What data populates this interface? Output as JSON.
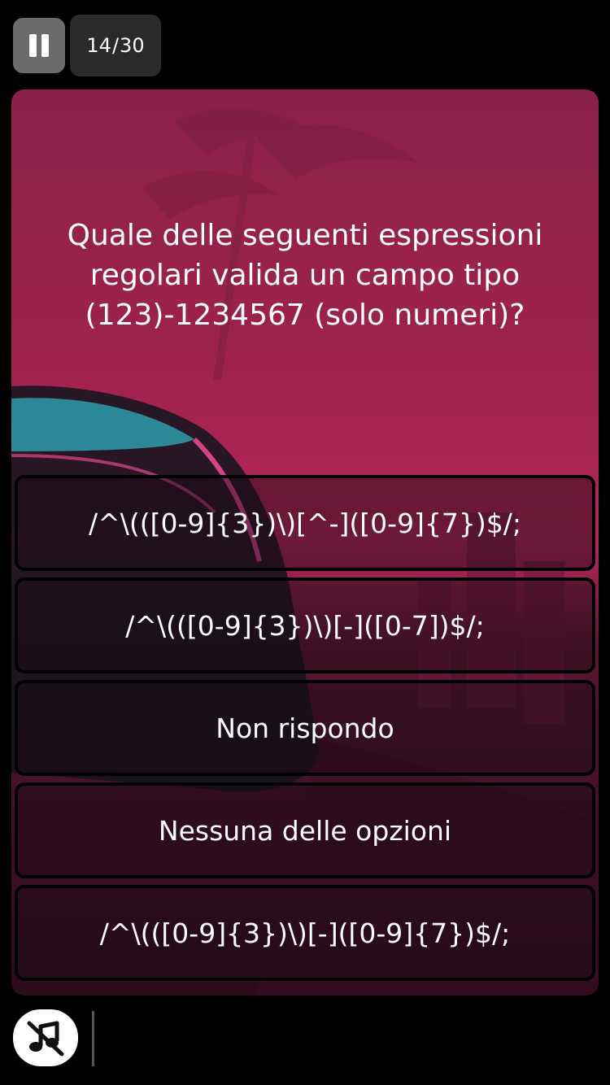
{
  "header": {
    "pause_icon": "pause-icon",
    "progress": {
      "current": "14",
      "separator": "/",
      "total": "30"
    }
  },
  "question": {
    "text": "Quale delle seguenti espressioni regolari valida un campo tipo (123)-1234567 (solo numeri)?"
  },
  "answers": [
    {
      "label": "/^\\(([0-9]{3})\\)[^-]([0-9]{7})$/;"
    },
    {
      "label": "/^\\(([0-9]{3})\\)[-]([0-7])$/;"
    },
    {
      "label": "Non rispondo"
    },
    {
      "label": "Nessuna delle opzioni"
    },
    {
      "label": "/^\\(([0-9]{3})\\)[-]([0-9]{7})$/;"
    }
  ],
  "footer": {
    "music_icon": "music-off-icon"
  },
  "colors": {
    "background": "#000000",
    "card_top": "#8a2148",
    "card_mid": "#b32759",
    "card_bottom": "#2a0c1a",
    "pause_bg": "#6b6b6b",
    "progress_bg": "#2a2a2a"
  }
}
